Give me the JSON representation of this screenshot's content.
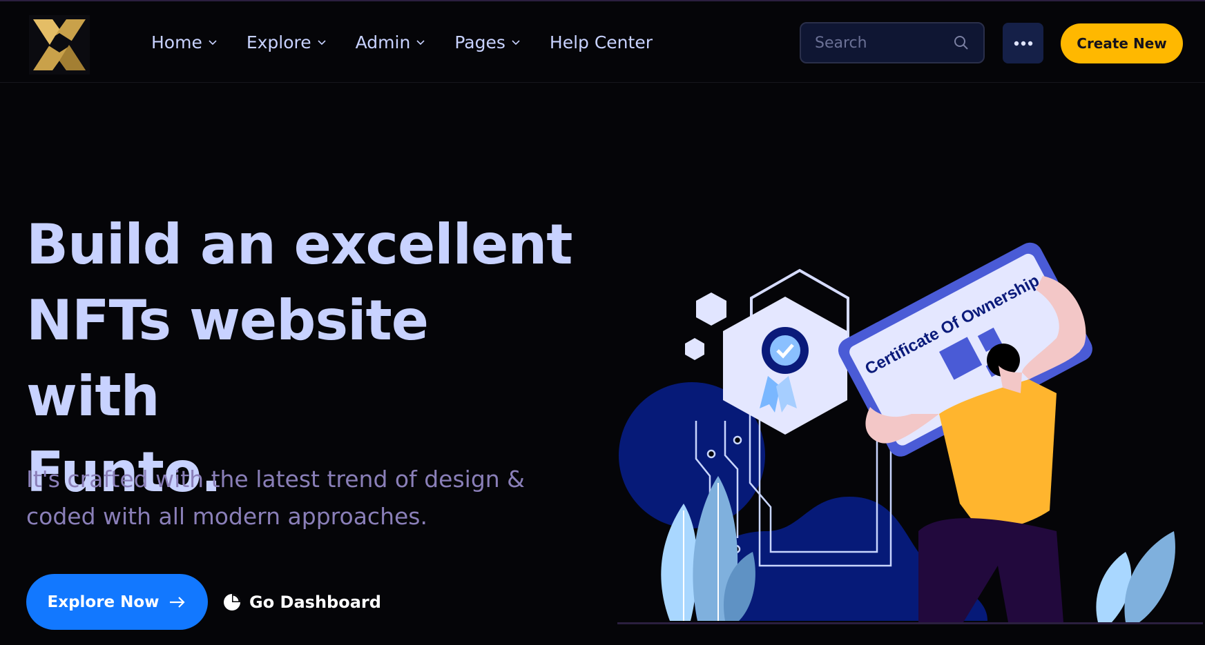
{
  "nav": {
    "items": [
      {
        "label": "Home",
        "has_dropdown": true
      },
      {
        "label": "Explore",
        "has_dropdown": true
      },
      {
        "label": "Admin",
        "has_dropdown": true
      },
      {
        "label": "Pages",
        "has_dropdown": true
      },
      {
        "label": "Help Center",
        "has_dropdown": false
      }
    ]
  },
  "search": {
    "placeholder": "Search",
    "icon": "search-icon"
  },
  "header": {
    "more_icon": "more-dots-icon",
    "create_label": "Create New"
  },
  "hero": {
    "title_lines": [
      "Build an excellent",
      "NFTs website with",
      "Funto."
    ],
    "subtitle_lines": [
      "It's crafted with the latest trend of design &",
      "coded with all modern approaches."
    ],
    "explore_label": "Explore Now",
    "dashboard_label": "Go Dashboard"
  },
  "illustration": {
    "certificate_text": "Certificate Of Ownership"
  },
  "colors": {
    "background": "#050508",
    "accent_yellow": "#ffb800",
    "accent_blue": "#1278ff",
    "text_primary": "#c8d2ff",
    "text_muted": "#8a7fb8"
  }
}
